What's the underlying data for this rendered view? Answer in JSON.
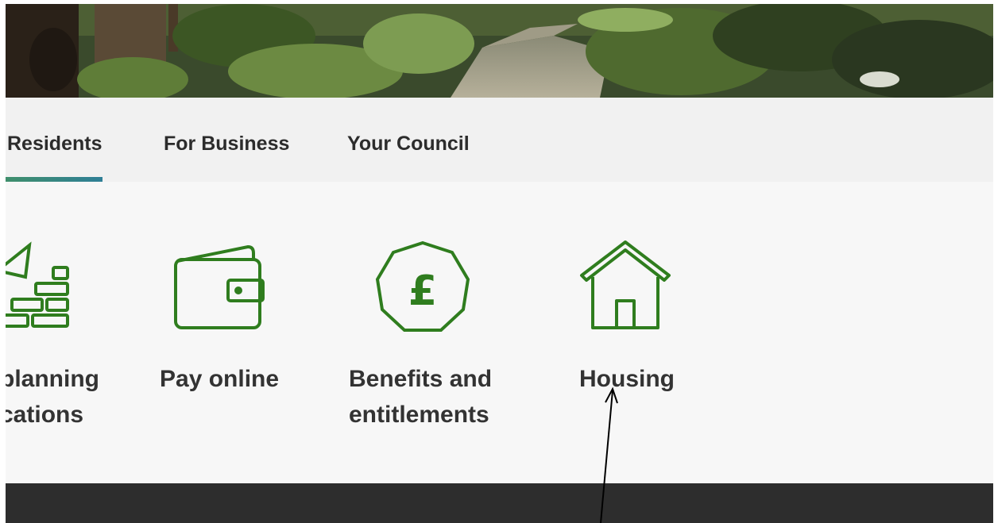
{
  "nav": {
    "tabs": [
      {
        "label": "Residents",
        "active": true
      },
      {
        "label": "For Business",
        "active": false
      },
      {
        "label": "Your Council",
        "active": false
      }
    ]
  },
  "services": [
    {
      "line1": "planning",
      "line2": "cations",
      "icon": "bricks-trowel-icon"
    },
    {
      "line1": "Pay online",
      "line2": "",
      "icon": "wallet-icon"
    },
    {
      "line1": "Benefits and",
      "line2": "entitlements",
      "icon": "pound-coin-icon"
    },
    {
      "line1": "Housing",
      "line2": "",
      "icon": "house-icon"
    }
  ],
  "colors": {
    "icon_green": "#2f7d1e",
    "tab_underline": "#3f8f6c",
    "footer": "#2d2d2d",
    "annotation": "#000000"
  },
  "hero_image": "woodland-path-photo"
}
